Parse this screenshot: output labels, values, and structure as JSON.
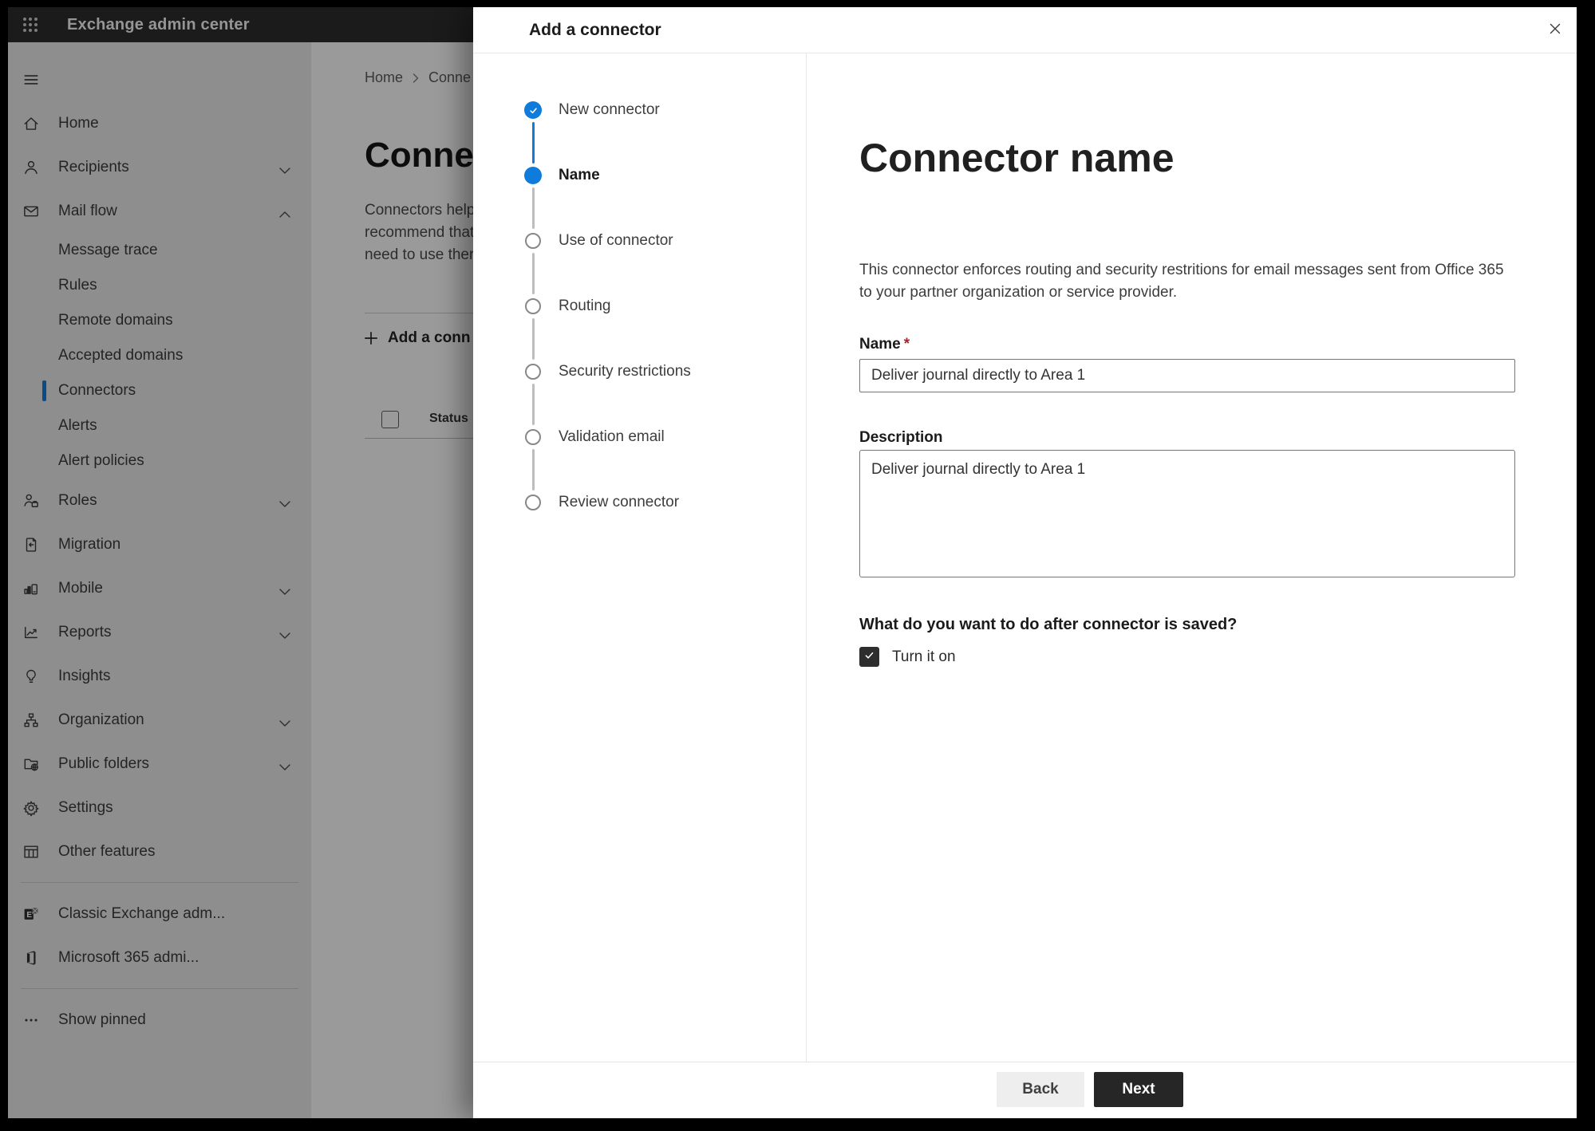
{
  "header": {
    "app_title": "Exchange admin center"
  },
  "sidebar": {
    "items": [
      {
        "label": "Home",
        "icon": "home",
        "type": "item"
      },
      {
        "label": "Recipients",
        "icon": "person",
        "type": "item",
        "chevron": "down"
      },
      {
        "label": "Mail flow",
        "icon": "mail",
        "type": "item",
        "chevron": "up"
      },
      {
        "label": "Message trace",
        "type": "subitem"
      },
      {
        "label": "Rules",
        "type": "subitem"
      },
      {
        "label": "Remote domains",
        "type": "subitem"
      },
      {
        "label": "Accepted domains",
        "type": "subitem"
      },
      {
        "label": "Connectors",
        "type": "subitem",
        "selected": true
      },
      {
        "label": "Alerts",
        "type": "subitem"
      },
      {
        "label": "Alert policies",
        "type": "subitem"
      },
      {
        "label": "Roles",
        "icon": "roles",
        "type": "item",
        "chevron": "down"
      },
      {
        "label": "Migration",
        "icon": "migration",
        "type": "item"
      },
      {
        "label": "Mobile",
        "icon": "mobile",
        "type": "item",
        "chevron": "down"
      },
      {
        "label": "Reports",
        "icon": "reports",
        "type": "item",
        "chevron": "down"
      },
      {
        "label": "Insights",
        "icon": "insights",
        "type": "item"
      },
      {
        "label": "Organization",
        "icon": "organization",
        "type": "item",
        "chevron": "down"
      },
      {
        "label": "Public folders",
        "icon": "public-folders",
        "type": "item",
        "chevron": "down"
      },
      {
        "label": "Settings",
        "icon": "settings",
        "type": "item"
      },
      {
        "label": "Other features",
        "icon": "other-features",
        "type": "item"
      },
      {
        "type": "divider"
      },
      {
        "label": "Classic Exchange adm...",
        "icon": "exchange-logo",
        "type": "item"
      },
      {
        "label": "Microsoft 365 admi...",
        "icon": "m365-logo",
        "type": "item"
      },
      {
        "type": "divider"
      },
      {
        "label": "Show pinned",
        "icon": "ellipsis",
        "type": "item"
      }
    ]
  },
  "background_page": {
    "breadcrumb": [
      "Home",
      "Conne"
    ],
    "heading": "Connect",
    "description_lines": [
      "Connectors help",
      "recommend that",
      "need to use ther"
    ],
    "add_button_label": "Add a conn",
    "table": {
      "columns": [
        "Status"
      ]
    }
  },
  "panel": {
    "title": "Add a connector",
    "steps": [
      {
        "label": "New connector",
        "state": "completed"
      },
      {
        "label": "Name",
        "state": "current"
      },
      {
        "label": "Use of connector",
        "state": "upcoming"
      },
      {
        "label": "Routing",
        "state": "upcoming"
      },
      {
        "label": "Security restrictions",
        "state": "upcoming"
      },
      {
        "label": "Validation email",
        "state": "upcoming"
      },
      {
        "label": "Review connector",
        "state": "upcoming"
      }
    ],
    "content": {
      "title": "Connector name",
      "description_lines": [
        "This connector enforces routing and security restritions for email messages sent from Office 365",
        "to your partner organization or service provider."
      ],
      "name_label": "Name",
      "required_mark": "*",
      "name_value": "Deliver journal directly to Area 1",
      "description_label": "Description",
      "description_value": "Deliver journal directly to Area 1",
      "after_save_question": "What do you want to do after connector is saved?",
      "turn_on_label": "Turn it on",
      "turn_on_checked": true
    },
    "footer": {
      "back_label": "Back",
      "next_label": "Next"
    }
  },
  "colors": {
    "accent": "#0f7bdb",
    "required": "#a4262c",
    "next_button": "#262626"
  }
}
